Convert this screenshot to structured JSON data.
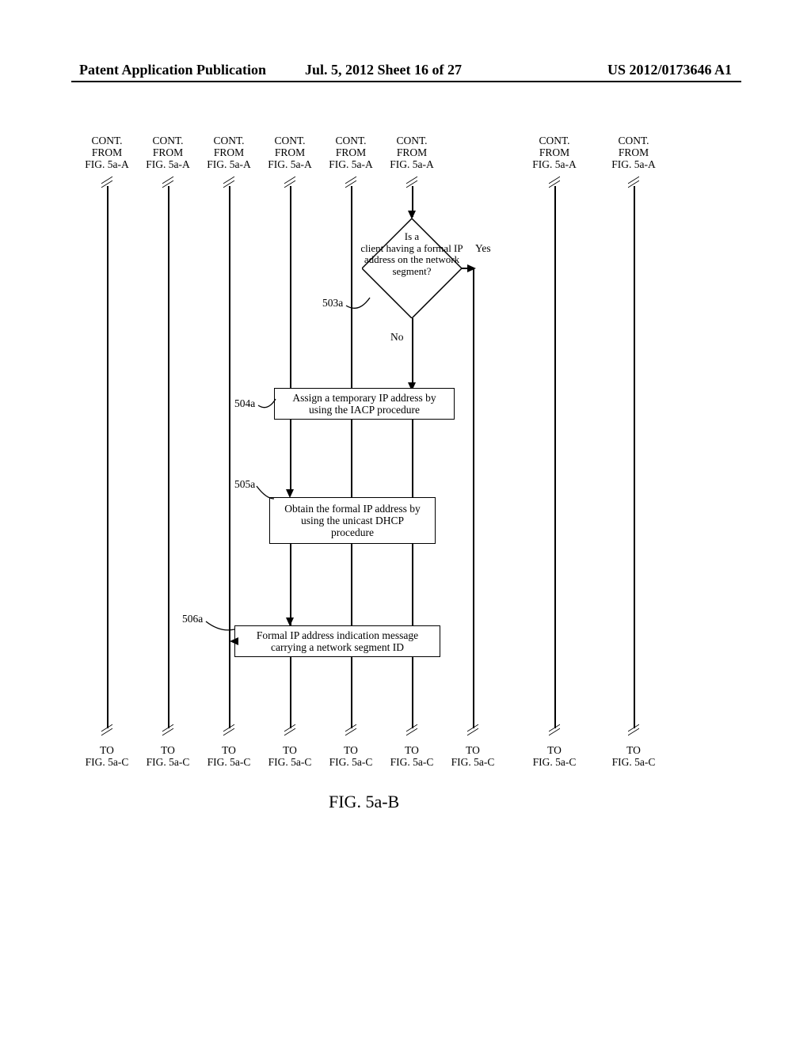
{
  "header": {
    "left": "Patent Application Publication",
    "mid": "Jul. 5, 2012   Sheet 16 of 27",
    "right": "US 2012/0173646 A1"
  },
  "figure_caption": "FIG. 5a-B",
  "lanes": {
    "from_text": [
      "CONT.",
      "FROM",
      "FIG. 5a-A"
    ],
    "to_text": [
      "TO",
      "FIG. 5a-C"
    ]
  },
  "decision": {
    "text": [
      "Is a",
      "client having a formal IP",
      "address on the network",
      "segment?"
    ],
    "yes": "Yes",
    "no": "No",
    "ref": "503a"
  },
  "steps": {
    "step504": {
      "ref": "504a",
      "lines": [
        "Assign a temporary IP address by",
        "using the IACP procedure"
      ]
    },
    "step505": {
      "ref": "505a",
      "lines": [
        "Obtain the formal IP address by",
        "using the unicast DHCP",
        "procedure"
      ]
    },
    "step506": {
      "ref": "506a",
      "lines": [
        "Formal IP address indication message",
        "carrying a network segment ID"
      ]
    }
  },
  "chart_data": {
    "type": "flowchart-continuation",
    "lane_count": 9,
    "lanes_with_top_cont_label": [
      0,
      1,
      2,
      3,
      4,
      5,
      7,
      8
    ],
    "lanes_with_bottom_to_label": [
      0,
      1,
      2,
      3,
      4,
      5,
      6,
      7,
      8
    ],
    "decision_lane": 5,
    "nodes": [
      {
        "id": "503a",
        "type": "decision",
        "text": "Is a client having a formal IP address on the network segment?",
        "lane": 5
      },
      {
        "id": "504a",
        "type": "process",
        "text": "Assign a temporary IP address by using the IACP procedure",
        "span": [
          3,
          5
        ]
      },
      {
        "id": "505a",
        "type": "process",
        "text": "Obtain the formal IP address by using the unicast DHCP procedure",
        "span": [
          3,
          4
        ]
      },
      {
        "id": "506a",
        "type": "message",
        "text": "Formal IP address indication message carrying a network segment ID",
        "span": [
          2,
          5
        ]
      }
    ],
    "edges": [
      {
        "from": "lane5-in",
        "to": "503a"
      },
      {
        "from": "503a",
        "to": "504a",
        "label": "No",
        "condition": "no"
      },
      {
        "from": "503a",
        "to": "lane6-out",
        "label": "Yes",
        "condition": "yes"
      },
      {
        "from": "504a",
        "to": "505a",
        "via_lane": 3
      },
      {
        "from": "505a",
        "to": "506a"
      },
      {
        "from": "506a",
        "to": "lane2-out",
        "direction": "left"
      },
      {
        "from": "506a",
        "to": "lane5-out"
      }
    ]
  }
}
